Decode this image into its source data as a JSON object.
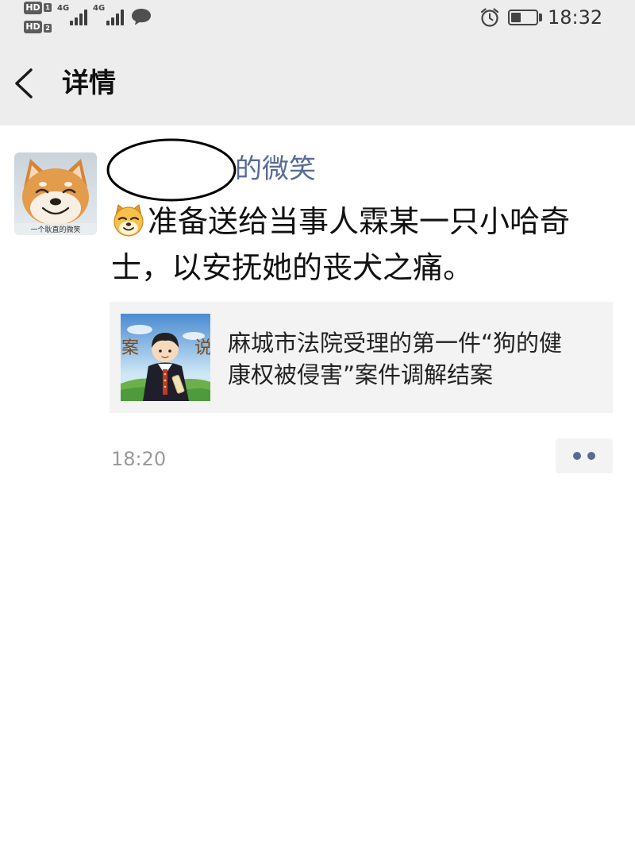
{
  "status_bar": {
    "sim1_badge": "HD",
    "sim1_slot": "1",
    "sim2_badge": "HD",
    "sim2_slot": "2",
    "network1": "4G",
    "network2": "4G",
    "signal1_bars": 4,
    "signal2_bars": 4,
    "notification_icon": "chat-bubble-icon",
    "alarm_icon": "alarm-clock-icon",
    "battery_icon": "battery-icon",
    "battery_level": 0.4,
    "time": "18:32"
  },
  "header": {
    "back_icon": "chevron-left-icon",
    "title": "详情"
  },
  "post": {
    "avatar_caption": "一个耿直的微笑",
    "author_name": "的微笑",
    "emoji_icon": "doge-emoji-icon",
    "text": "准备送给当事人霖某一只小哈奇士，以安抚她的丧犬之痛。",
    "link": {
      "title": "麻城市法院受理的第一件“狗的健康权被侵害”案件调解结案",
      "thumbnail_text_left": "案",
      "thumbnail_text_right": "说"
    },
    "time": "18:20",
    "comment_icon": "more-dots-icon"
  },
  "colors": {
    "accent": "#576b95",
    "header_bg": "#ededed",
    "card_bg": "#f3f3f3",
    "time_text": "#999999"
  }
}
